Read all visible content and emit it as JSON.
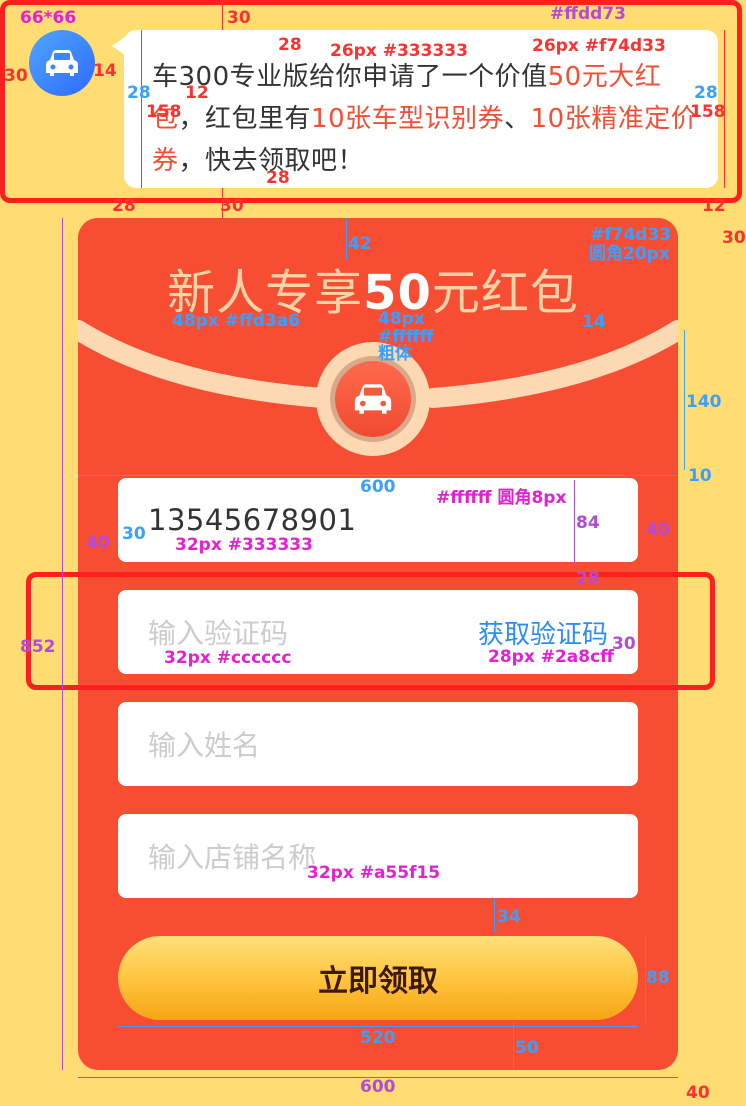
{
  "message": {
    "parts": [
      {
        "text": "车300专业版给你申请了一个价值",
        "highlight": false
      },
      {
        "text": "50元大红包",
        "highlight": true
      },
      {
        "text": "，红包里有",
        "highlight": false
      },
      {
        "text": "10张车型识别券",
        "highlight": true
      },
      {
        "text": "、",
        "highlight": false
      },
      {
        "text": "10张精准定价券",
        "highlight": true
      },
      {
        "text": "，快去领取吧！",
        "highlight": false
      }
    ]
  },
  "card": {
    "title_prefix": "新人专享",
    "title_amount": "50",
    "title_suffix": "元红包"
  },
  "form": {
    "phone_value": "13545678901",
    "code_placeholder": "输入验证码",
    "get_code_label": "获取验证码",
    "name_placeholder": "输入姓名",
    "store_placeholder": "输入店铺名称",
    "submit_label": "立即领取"
  },
  "annotations": {
    "avatar_size": "66*66",
    "bg_color": "#ffdd73",
    "t30": "30",
    "t28": "28",
    "t14": "14",
    "t12": "12",
    "t158": "158",
    "text_spec_dark": "26px #333333",
    "text_spec_hl": "26px #f74d33",
    "card_spec": "#f74d33",
    "card_radius": "圆角20px",
    "n42": "42",
    "title_spec": "48px #ffd3a6",
    "amount_spec_1": "48px",
    "amount_spec_2": "#ffffff",
    "amount_spec_3": "粗体",
    "n140": "140",
    "n10": "10",
    "n600": "600",
    "input_spec": "#ffffff 圆角8px",
    "n40": "40",
    "n84": "84",
    "phone_spec": "32px #333333",
    "n852": "852",
    "ph_spec": "32px #cccccc",
    "link_spec": "28px #2a8cff",
    "store_spec": "32px #a55f15",
    "n34": "34",
    "n88": "88",
    "n520": "520",
    "n50": "50"
  },
  "colors": {
    "background": "#ffdd73",
    "card": "#f74d33",
    "title": "#ffd3a6",
    "link": "#2a8cff",
    "text": "#333333",
    "placeholder": "#cccccc"
  }
}
